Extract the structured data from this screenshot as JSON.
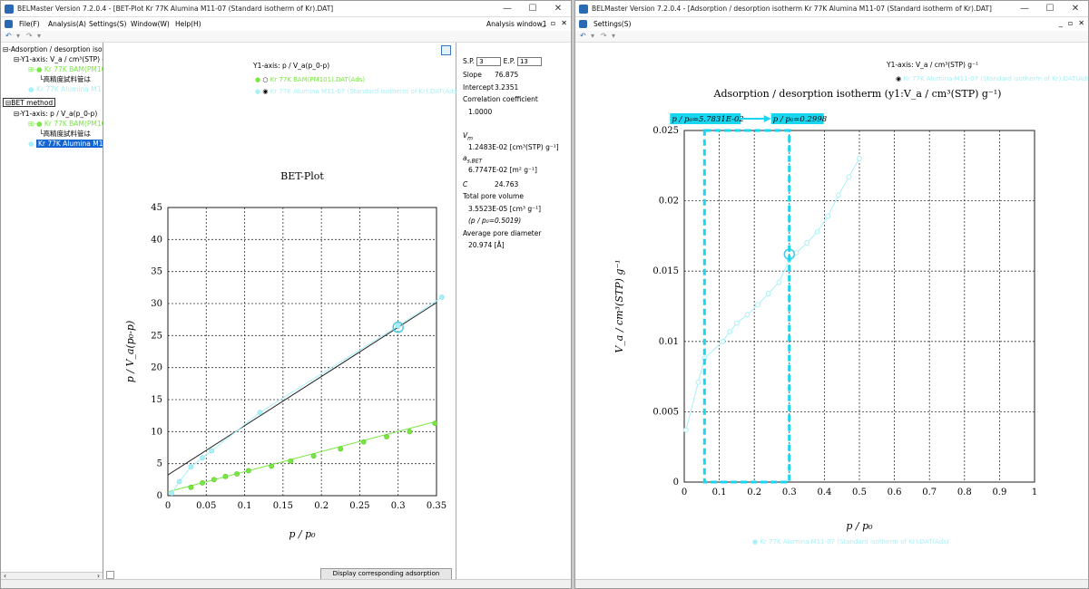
{
  "window1": {
    "title": "BELMaster Version 7.2.0.4 - [BET-Plot Kr 77K Alumina M11-07 (Standard isotherm of Kr).DAT]",
    "buttons": {
      "minimize": "—",
      "maximize": "☐",
      "close": "✕"
    },
    "menus": [
      "File(F)",
      "Analysis(A)",
      "Settings(S)",
      "Window(W)",
      "Help(H)"
    ],
    "mdi_label": "Analysis window1",
    "mdi_buttons": [
      "_",
      "▫",
      "✕"
    ],
    "tree": {
      "n1": "Adsorption / desorption isoth",
      "n2": "Y1-axis: V_a / cm³(STP) g",
      "n3": "Kr 77K BAM(PM101",
      "n4": "高精度試料管は",
      "n5": "Kr 77K Alumina M1",
      "n6": "BET method",
      "n7": "Y1-axis:  p / V_a(p_0-p)",
      "n8": "Kr 77K BAM(PM101",
      "n9": "高精度試料管は",
      "n10": "Kr 77K Alumina M1"
    },
    "legend": {
      "axis_label": "Y1-axis:  p / V_a(p_0-p)",
      "item1": "Kr 77K BAM(PM101).DAT(Ads)",
      "item2": "Kr 77K Alumina M11-07 (Standard isotherm of Kr).DAT(Ads)"
    },
    "display_button": "Display corresponding adsorption isotherm",
    "info": {
      "sp_label": "S.P.",
      "sp_value": "3",
      "ep_label": "E.P.",
      "ep_value": "13",
      "slope_label": "Slope",
      "slope_value": "76.875",
      "intercept_label": "Intercept",
      "intercept_value": "3.2351",
      "corr_label": "Correlation coefficient",
      "corr_value": "1.0000",
      "vm_label": "V",
      "vm_sub": "m",
      "vm_value": "1.2483E-02 [cm³(STP) g⁻¹]",
      "as_label": "a",
      "as_sub": "s,BET",
      "as_value": "6.7747E-02 [m² g⁻¹]",
      "c_label": "C",
      "c_value": "24.763",
      "tpv_label": "Total pore volume",
      "tpv_value": "3.5523E-05 [cm³ g⁻¹]",
      "tpv_p": "(p / p₀=0.5019)",
      "apd_label": "Average pore diameter",
      "apd_value": "20.974 [Å]"
    }
  },
  "window2": {
    "title": "BELMaster Version 7.2.0.4 - [Adsorption / desorption isotherm Kr 77K Alumina M11-07 (Standard isotherm of Kr).DAT]",
    "buttons": {
      "minimize": "—",
      "maximize": "☐",
      "close": "✕"
    },
    "menus": [
      "Settings(S)"
    ],
    "mdi_buttons": [
      "_",
      "▫",
      "✕"
    ],
    "legend": {
      "axis_label": "Y1-axis: V_a / cm³(STP) g⁻¹",
      "item": "Kr 77K Alumina M11-07 (Standard isotherm of Kr).DAT(Ads)"
    },
    "footer_legend": "Kr 77K Alumina M11-07 (Standard isotherm of Kr).DAT(Ads)"
  },
  "chart_data": [
    {
      "type": "scatter",
      "title": "BET-Plot",
      "xlabel": "p / p₀",
      "ylabel": "p / V_a(p₀-p)",
      "xlim": [
        0,
        0.35
      ],
      "ylim": [
        0,
        45
      ],
      "xticks": [
        "0",
        "0.05",
        "0.1",
        "0.15",
        "0.2",
        "0.25",
        "0.3",
        "0.35"
      ],
      "yticks": [
        "0",
        "5",
        "10",
        "15",
        "20",
        "25",
        "30",
        "35",
        "40",
        "45"
      ],
      "grid": true,
      "series": [
        {
          "name": "Kr 77K BAM(PM101).DAT(Ads)",
          "color": "#77e840",
          "x": [
            0.03,
            0.045,
            0.06,
            0.075,
            0.09,
            0.105,
            0.135,
            0.16,
            0.19,
            0.225,
            0.255,
            0.285,
            0.315,
            0.348
          ],
          "y": [
            1.3,
            2.0,
            2.5,
            3.0,
            3.4,
            3.9,
            4.6,
            5.4,
            6.2,
            7.3,
            8.4,
            9.2,
            10.0,
            11.3
          ],
          "fit": {
            "x": [
              0,
              0.35
            ],
            "y": [
              0.6,
              11.6
            ],
            "color": "#77e840"
          }
        },
        {
          "name": "Kr 77K Alumina M11-07 (Standard isotherm of Kr).DAT(Ads)",
          "color": "#a8f0f8",
          "x": [
            0.005,
            0.015,
            0.03,
            0.045,
            0.057,
            0.12,
            0.3,
            0.357
          ],
          "y": [
            0.4,
            2.2,
            4.5,
            5.9,
            7.0,
            13.0,
            26.5,
            31.0
          ],
          "fit": {
            "x": [
              0,
              0.35
            ],
            "y": [
              3.2351,
              30.14
            ],
            "color": "#202020"
          },
          "highlight": {
            "x": 0.3,
            "y": 26.3
          }
        }
      ]
    },
    {
      "type": "line",
      "title": "Adsorption / desorption isotherm (y1:V_a / cm³(STP) g⁻¹)",
      "xlabel": "p / p₀",
      "ylabel": "V_a / cm³(STP) g⁻¹",
      "xlim": [
        0,
        1
      ],
      "ylim": [
        0,
        0.025
      ],
      "xticks": [
        "0",
        "0.1",
        "0.2",
        "0.3",
        "0.4",
        "0.5",
        "0.6",
        "0.7",
        "0.8",
        "0.9",
        "1"
      ],
      "yticks": [
        "0",
        "0.005",
        "0.01",
        "0.015",
        "0.02",
        "0.025"
      ],
      "grid": true,
      "series": [
        {
          "name": "Kr 77K Alumina M11-07 (Standard isotherm of Kr).DAT(Ads)",
          "color": "#a8f0f8",
          "x": [
            0.005,
            0.04,
            0.058,
            0.11,
            0.13,
            0.15,
            0.18,
            0.21,
            0.24,
            0.27,
            0.3,
            0.32,
            0.35,
            0.38,
            0.41,
            0.44,
            0.47,
            0.5
          ],
          "y": [
            0.0037,
            0.0071,
            0.0088,
            0.01,
            0.0107,
            0.0113,
            0.0119,
            0.0126,
            0.0134,
            0.0142,
            0.0158,
            0.0163,
            0.017,
            0.0178,
            0.0189,
            0.0204,
            0.0217,
            0.023
          ],
          "highlight": {
            "x": 0.3,
            "y": 0.0162
          }
        }
      ],
      "range": {
        "x0": 0.057831,
        "x1": 0.2998
      },
      "annotations": {
        "start": "p / p₀=5.7831E-02",
        "end": "p / p₀=0.2998"
      }
    }
  ]
}
